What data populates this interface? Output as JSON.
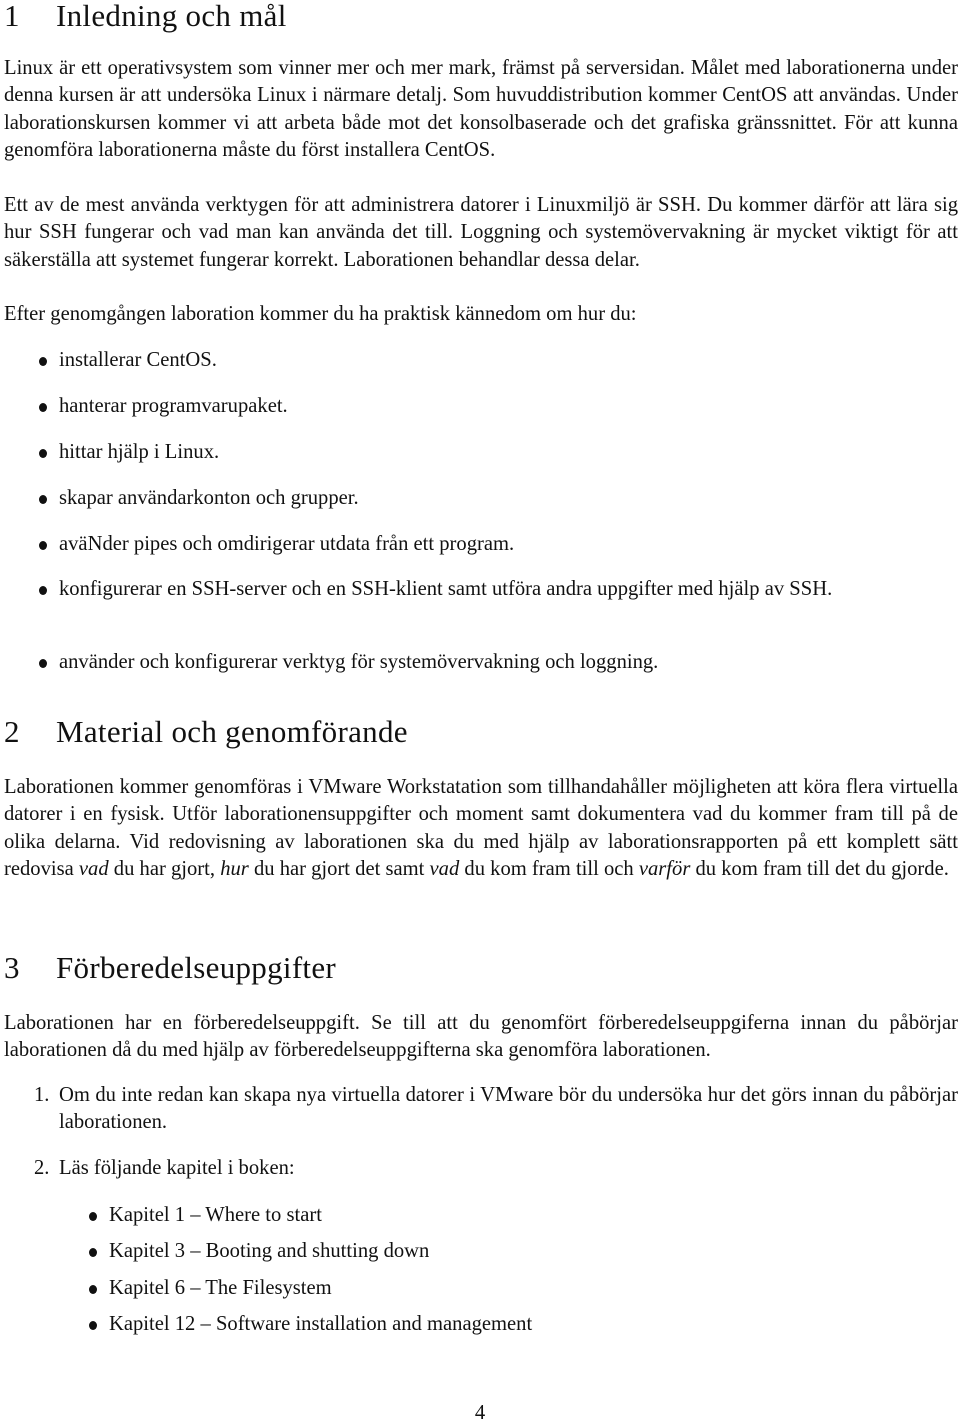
{
  "sections": [
    {
      "number": "1",
      "title": "Inledning och mål",
      "paragraphs": [
        "Linux är ett operativsystem som vinner mer och mer mark, främst på serversidan. Målet med laborationerna under denna kursen är att undersöka Linux i närmare detalj. Som huvuddistribution kommer CentOS att användas. Under laborationskursen kommer vi att arbeta både mot det konsolbaserade och det grafiska gränssnittet. För att kunna genomföra laborationerna måste du först installera CentOS.",
        "Ett av de mest använda verktygen för att administrera datorer i Linuxmiljö är SSH. Du kommer därför att lära sig hur SSH fungerar och vad man kan använda det till. Loggning och systemövervakning är mycket viktigt för att säkerställa att systemet fungerar korrekt. Laborationen behandlar dessa delar.",
        "Efter genomgången laboration kommer du ha praktisk kännedom om hur du:"
      ],
      "bullets": [
        "installerar CentOS.",
        "hanterar programvarupaket.",
        "hittar hjälp i Linux.",
        "skapar användarkonton och grupper.",
        "aväNder pipes och omdirigerar utdata från ett program.",
        "konfigurerar en SSH-server och en SSH-klient samt utföra andra uppgifter med hjälp av SSH.",
        "använder och konfigurerar verktyg för systemövervakning och loggning."
      ]
    },
    {
      "number": "2",
      "title": "Material och genomförande",
      "paragraph_parts": [
        {
          "text": "Laborationen kommer genomföras i VMware Workstatation som tillhandahåller möjligheten att köra flera virtuella datorer i en fysisk. Utför laborationensuppgifter och moment samt dokumentera vad du kommer fram till på de olika delarna. Vid redovisning av laborationen ska du med hjälp av laborationsrapporten på ett komplett sätt redovisa ",
          "italic": false
        },
        {
          "text": "vad",
          "italic": true
        },
        {
          "text": " du har gjort, ",
          "italic": false
        },
        {
          "text": "hur",
          "italic": true
        },
        {
          "text": " du har gjort det samt ",
          "italic": false
        },
        {
          "text": "vad",
          "italic": true
        },
        {
          "text": " du kom fram till och ",
          "italic": false
        },
        {
          "text": "varför",
          "italic": true
        },
        {
          "text": " du kom fram till det du gjorde.",
          "italic": false
        }
      ]
    },
    {
      "number": "3",
      "title": "Förberedelseuppgifter",
      "paragraph": "Laborationen har en förberedelseuppgift. Se till att du genomfört förberedelseuppgiferna innan du påbörjar laborationen då du med hjälp av förberedelseuppgifterna ska genomföra laborationen.",
      "enumerated": [
        {
          "label": "1.",
          "text": "Om du inte redan kan skapa nya virtuella datorer i VMware bör du undersöka hur det görs innan du påbörjar laborationen."
        },
        {
          "label": "2.",
          "text": "Läs följande kapitel i boken:"
        }
      ],
      "chapters": [
        "Kapitel 1 – Where to start",
        "Kapitel 3 – Booting and shutting down",
        "Kapitel 6 – The Filesystem",
        "Kapitel 12 – Software installation and management"
      ]
    }
  ],
  "page_number": "4"
}
